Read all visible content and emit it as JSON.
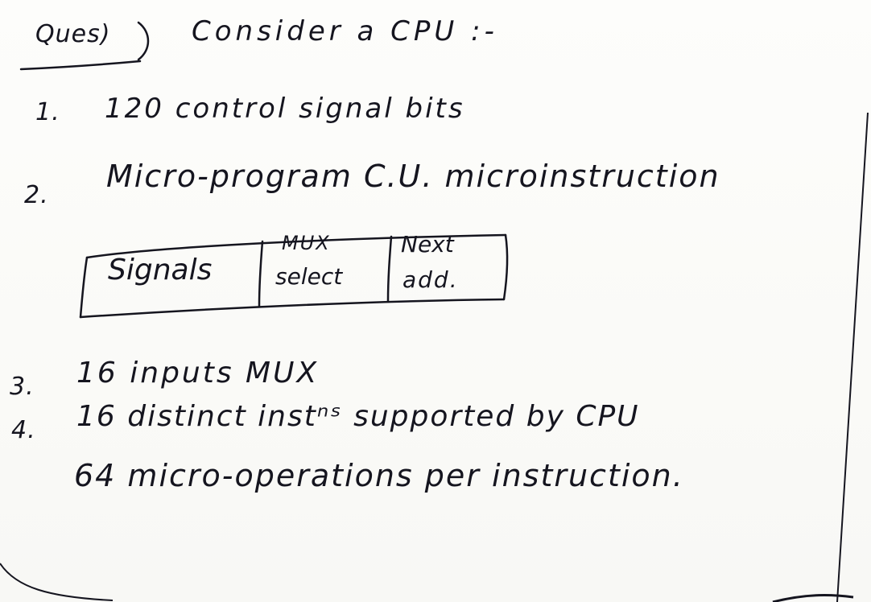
{
  "question": {
    "label": "Ques)",
    "heading": "Consider a CPU :-"
  },
  "items": [
    {
      "number": "1.",
      "text": "120 control signal bits"
    },
    {
      "number": "2.",
      "text": "Micro-program C.U. microinstruction"
    },
    {
      "number": "3.",
      "text": "16 inputs MUX"
    },
    {
      "number": "4.",
      "text": "16 distinct instⁿˢ supported by CPU"
    },
    {
      "number": "",
      "text": "64 micro-operations per instruction."
    }
  ],
  "microinstruction_format": {
    "fields": [
      {
        "label": "Signals"
      },
      {
        "label_line1": "MUX",
        "label_line2": "select"
      },
      {
        "label_line1": "Next",
        "label_line2": "add."
      }
    ]
  },
  "colors": {
    "ink": "#15151f",
    "paper": "#fbfbf9"
  }
}
